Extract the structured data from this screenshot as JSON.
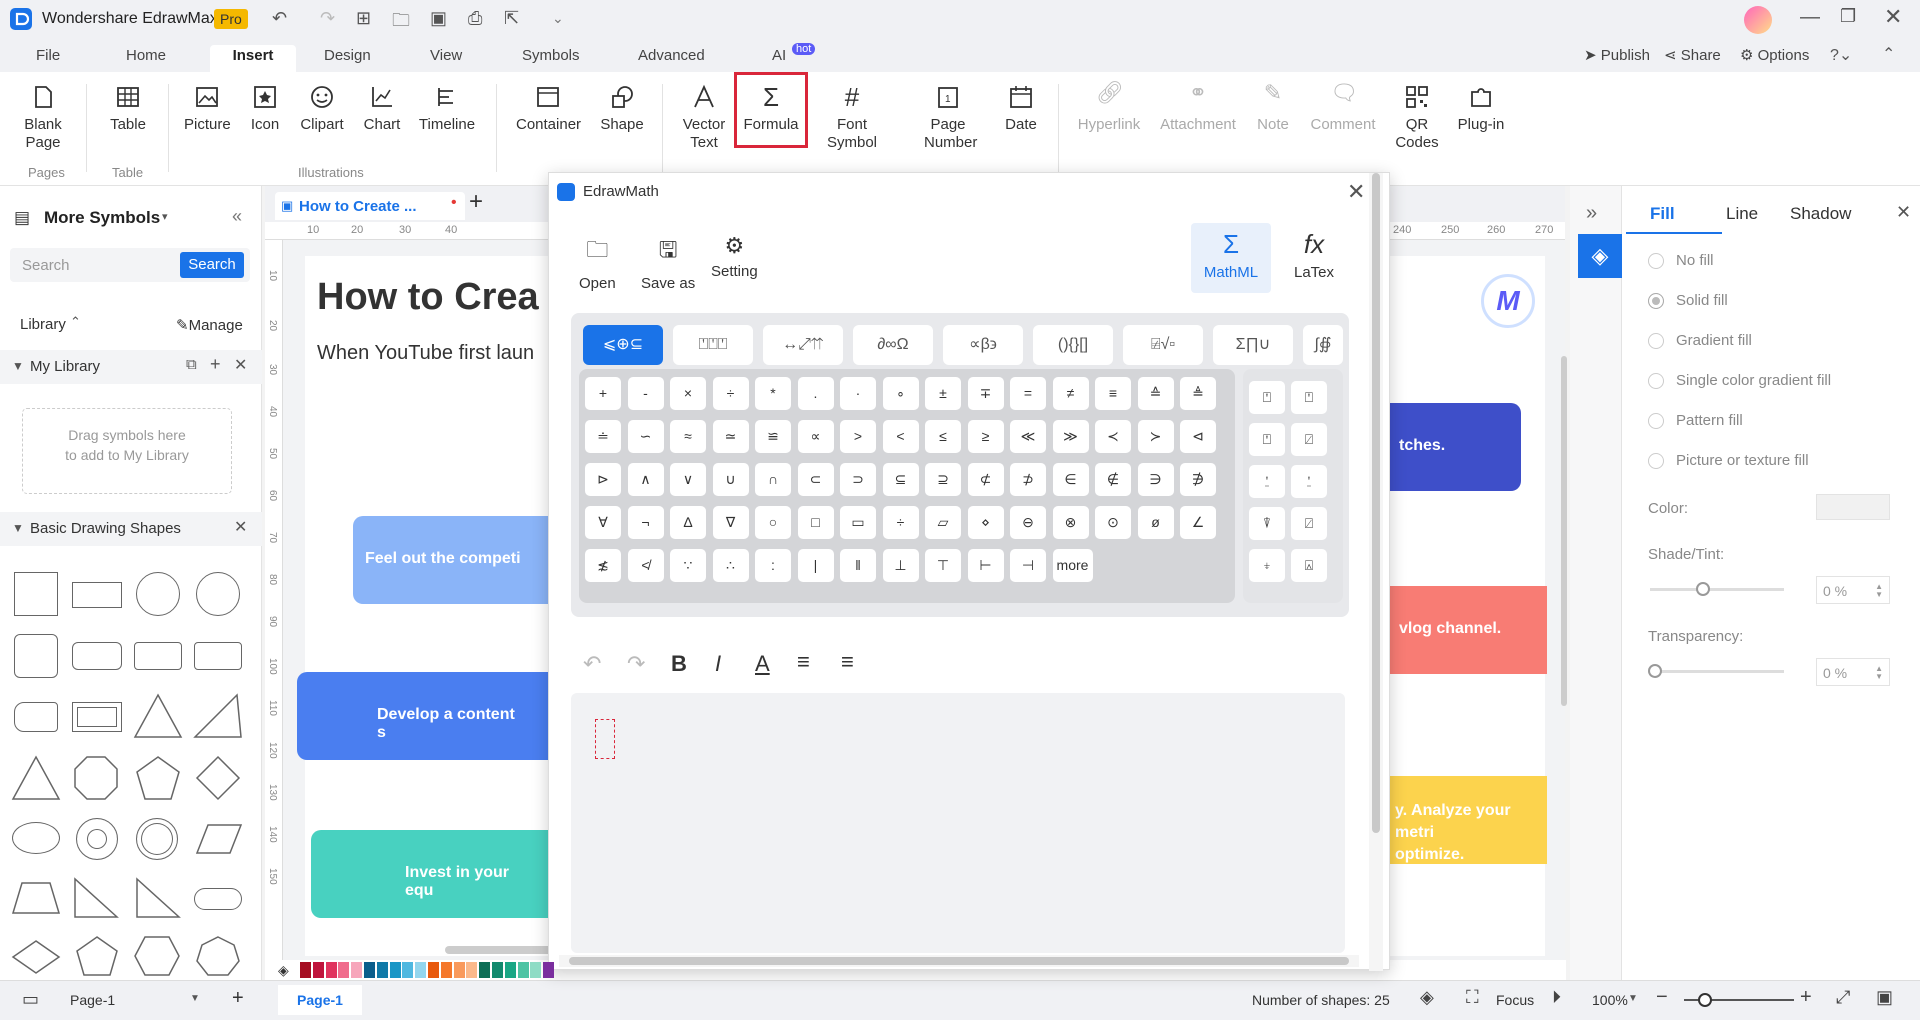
{
  "app": {
    "title": "Wondershare EdrawMax",
    "badge": "Pro"
  },
  "menu": {
    "tabs": [
      "File",
      "Home",
      "Insert",
      "Design",
      "View",
      "Symbols",
      "Advanced",
      "AI"
    ],
    "ai_badge": "hot",
    "active": "Insert",
    "right": {
      "publish": "Publish",
      "share": "Share",
      "options": "Options"
    }
  },
  "ribbon": {
    "buttons": [
      {
        "label": "Blank\nPage",
        "icon": "blank-page-icon"
      },
      {
        "label": "Table",
        "icon": "table-icon"
      },
      {
        "label": "Picture",
        "icon": "picture-icon"
      },
      {
        "label": "Icon",
        "icon": "icon-icon"
      },
      {
        "label": "Clipart",
        "icon": "clipart-icon"
      },
      {
        "label": "Chart",
        "icon": "chart-icon"
      },
      {
        "label": "Timeline",
        "icon": "timeline-icon"
      },
      {
        "label": "Container",
        "icon": "container-icon"
      },
      {
        "label": "Shape",
        "icon": "shape-icon"
      },
      {
        "label": "Vector\nText",
        "icon": "vector-text-icon"
      },
      {
        "label": "Formula",
        "icon": "formula-icon"
      },
      {
        "label": "Font\nSymbol",
        "icon": "font-symbol-icon"
      },
      {
        "label": "Page\nNumber",
        "icon": "page-number-icon"
      },
      {
        "label": "Date",
        "icon": "date-icon"
      },
      {
        "label": "Hyperlink",
        "icon": "hyperlink-icon"
      },
      {
        "label": "Attachment",
        "icon": "attachment-icon"
      },
      {
        "label": "Note",
        "icon": "note-icon"
      },
      {
        "label": "Comment",
        "icon": "comment-icon"
      },
      {
        "label": "QR\nCodes",
        "icon": "qr-codes-icon"
      },
      {
        "label": "Plug-in",
        "icon": "plug-in-icon"
      }
    ],
    "groups": {
      "pages": "Pages",
      "table": "Table",
      "illustrations": "Illustrations"
    }
  },
  "left": {
    "title": "More Symbols",
    "search_placeholder": "Search",
    "search_btn": "Search",
    "library": "Library",
    "manage": "Manage",
    "my_library": "My Library",
    "drag_hint": "Drag symbols here to add to My Library",
    "basic_shapes": "Basic Drawing Shapes"
  },
  "doc": {
    "tab": "How to Create ...",
    "heading": "How to Crea",
    "subtext": "When YouTube first laun",
    "card1": "Feel out the competi",
    "card2": "Develop a content s",
    "card3": "Invest in your equ",
    "card_r1": "tches.",
    "card_r2": "vlog channel.",
    "card_r3a": "y. Analyze your metri",
    "card_r3b": "optimize.",
    "ruler": [
      "10",
      "20",
      "30",
      "40",
      "240",
      "250",
      "260",
      "270"
    ],
    "vruler": [
      "10",
      "20",
      "30",
      "40",
      "50",
      "60",
      "70",
      "80",
      "90",
      "100",
      "110",
      "120",
      "130",
      "140",
      "150"
    ]
  },
  "right": {
    "tabs": [
      "Fill",
      "Line",
      "Shadow"
    ],
    "fill_options": [
      "No fill",
      "Solid fill",
      "Gradient fill",
      "Single color gradient fill",
      "Pattern fill",
      "Picture or texture fill"
    ],
    "color": "Color:",
    "shade": "Shade/Tint:",
    "shade_val": "0 %",
    "transparency": "Transparency:",
    "transparency_val": "0 %"
  },
  "dialog": {
    "title": "EdrawMath",
    "open": "Open",
    "save_as": "Save as",
    "setting": "Setting",
    "mathml": "MathML",
    "latex": "LaTex",
    "categories": [
      "⩽⊕⊆",
      "⍞⍞⍞",
      "↔⤢⇈",
      "∂∞Ω",
      "∝β϶",
      "(){}[]",
      "⍯√▫",
      "Σ∏∪",
      "∫∯"
    ],
    "keys": [
      [
        "+",
        "-",
        "×",
        "÷",
        "*",
        ".",
        "·",
        "∘",
        "±",
        "∓",
        "=",
        "≠",
        "≡",
        "≙",
        "≜"
      ],
      [
        "≐",
        "∽",
        "≈",
        "≃",
        "≌",
        "∝",
        ">",
        "<",
        "≤",
        "≥",
        "≪",
        "≫",
        "≺",
        "≻",
        "⊲"
      ],
      [
        "⊳",
        "∧",
        "∨",
        "∪",
        "∩",
        "⊂",
        "⊃",
        "⊆",
        "⊇",
        "⊄",
        "⊅",
        "∈",
        "∉",
        "∋",
        "∌"
      ],
      [
        "∀",
        "¬",
        "∆",
        "∇",
        "○",
        "□",
        "▭",
        "÷",
        "▱",
        "⋄",
        "⊖",
        "⊗",
        "⊙",
        "ø",
        "∠"
      ],
      [
        "≴",
        "≮",
        "∵",
        "∴",
        ":",
        "|",
        "‖",
        "⊥",
        "⊤",
        "⊢",
        "⊣",
        "more"
      ]
    ]
  },
  "status": {
    "page_sel": "Page-1",
    "page_tab": "Page-1",
    "shapes": "Number of shapes: 25",
    "focus": "Focus",
    "zoom": "100%"
  },
  "colors": {
    "accent": "#1a73e8",
    "highlight": "#d9263a",
    "card1": "#8ab4f8",
    "card2": "#4a7ef0",
    "card3": "#48d1c0",
    "card_r1": "#3e4fc9",
    "card_r2": "#f87c74",
    "card_r3": "#fcd34d"
  }
}
